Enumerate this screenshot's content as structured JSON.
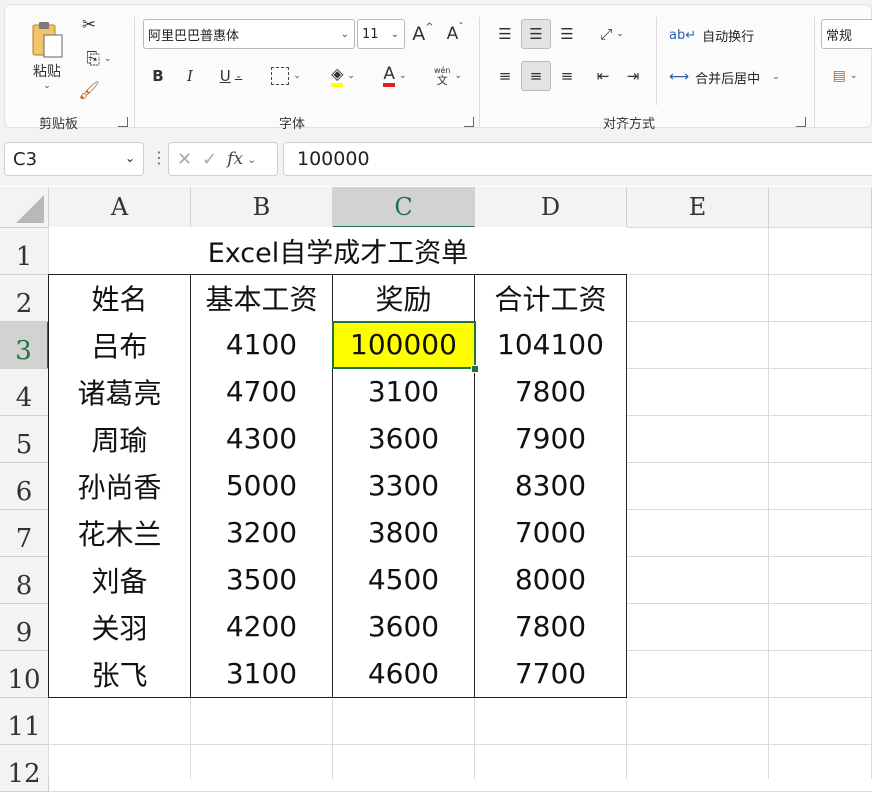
{
  "ribbon": {
    "clipboard": {
      "paste_label": "粘贴",
      "group_label": "剪贴板"
    },
    "font": {
      "font_name": "阿里巴巴普惠体",
      "font_size": "11",
      "bold": "B",
      "italic": "I",
      "underline": "U",
      "group_label": "字体",
      "wen_label": "wén",
      "wen_char": "文",
      "grow": "A",
      "shrink": "A"
    },
    "align": {
      "wrap_label": "自动换行",
      "merge_label": "合并后居中",
      "group_label": "对齐方式"
    },
    "number": {
      "format": "常规"
    }
  },
  "formula_bar": {
    "name_box": "C3",
    "formula": "100000",
    "fx": "fx"
  },
  "sheet": {
    "columns": [
      "A",
      "B",
      "C",
      "D",
      "E"
    ],
    "rows": [
      "1",
      "2",
      "3",
      "4",
      "5",
      "6",
      "7",
      "8",
      "9",
      "10",
      "11",
      "12"
    ],
    "title": "Excel自学成才工资单",
    "headers": [
      "姓名",
      "基本工资",
      "奖励",
      "合计工资"
    ],
    "data": [
      [
        "吕布",
        "4100",
        "100000",
        "104100"
      ],
      [
        "诸葛亮",
        "4700",
        "3100",
        "7800"
      ],
      [
        "周瑜",
        "4300",
        "3600",
        "7900"
      ],
      [
        "孙尚香",
        "5000",
        "3300",
        "8300"
      ],
      [
        "花木兰",
        "3200",
        "3800",
        "7000"
      ],
      [
        "刘备",
        "3500",
        "4500",
        "8000"
      ],
      [
        "关羽",
        "4200",
        "3600",
        "7800"
      ],
      [
        "张飞",
        "3100",
        "4600",
        "7700"
      ]
    ]
  },
  "colors": {
    "selection": "#217346",
    "highlight": "#ffff00"
  }
}
